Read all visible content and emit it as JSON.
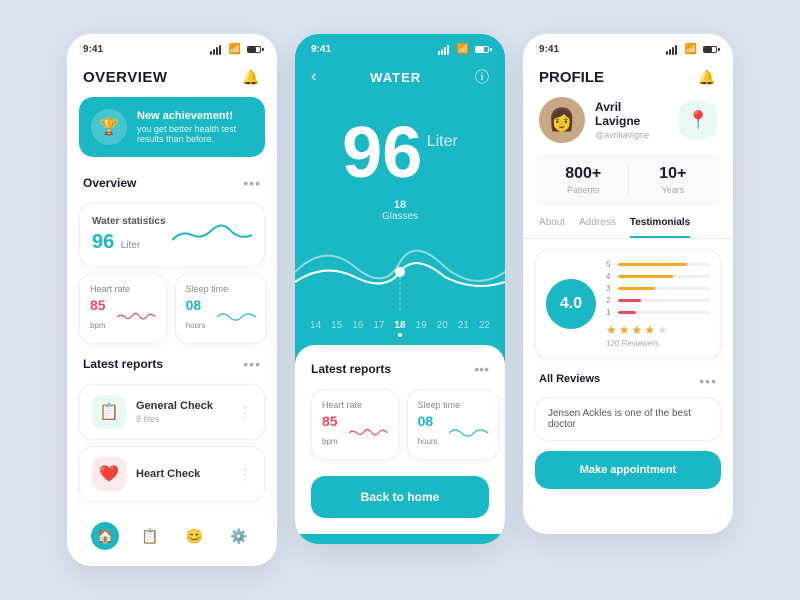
{
  "screens": {
    "overview": {
      "title": "OVERVIEW",
      "status_time": "9:41",
      "achievement": {
        "title": "New achievement!",
        "subtitle": "you get better health test results than before."
      },
      "overview_label": "Overview",
      "water_stats": {
        "title": "Water statistics",
        "value": "96",
        "unit": "Liter"
      },
      "heart_rate": {
        "label": "Heart rate",
        "value": "85",
        "unit": "bpm"
      },
      "sleep_time": {
        "label": "Sleep time",
        "value": "08",
        "unit": "hours"
      },
      "latest_reports": "Latest reports",
      "reports": [
        {
          "name": "General Check",
          "files": "8 files",
          "icon": "📋",
          "color": "green"
        },
        {
          "name": "Heart Check",
          "files": "",
          "icon": "❤️",
          "color": "red"
        }
      ],
      "nav": [
        "🏠",
        "📋",
        "😊",
        "⚙️"
      ]
    },
    "water": {
      "title": "WATER",
      "status_time": "9:41",
      "value": "96",
      "unit": "Liter",
      "glasses_count": "18",
      "glasses_label": "Glasses",
      "dates": [
        "14",
        "15",
        "16",
        "17",
        "18",
        "19",
        "20",
        "21",
        "22"
      ],
      "active_date": "18",
      "latest_reports": "Latest reports",
      "heart_rate": {
        "label": "Heart rate",
        "value": "85",
        "unit": "bpm"
      },
      "sleep_time": {
        "label": "Sleep time",
        "value": "08",
        "unit": "hours"
      },
      "back_btn": "Back to home"
    },
    "profile": {
      "title": "PROFILE",
      "status_time": "9:41",
      "name": "Avril Lavigne",
      "handle": "@avrillavigne",
      "patients": {
        "value": "800+",
        "label": "Patients"
      },
      "years": {
        "value": "10+",
        "label": "Years"
      },
      "tabs": [
        "About",
        "Address",
        "Testimonials"
      ],
      "active_tab": "Testimonials",
      "rating": {
        "score": "4.0",
        "bars": [
          {
            "label": "5",
            "fill": 75,
            "color": "orange"
          },
          {
            "label": "4",
            "fill": 60,
            "color": "orange"
          },
          {
            "label": "3",
            "fill": 40,
            "color": "orange"
          },
          {
            "label": "2",
            "fill": 25,
            "color": "red"
          },
          {
            "label": "1",
            "fill": 20,
            "color": "red"
          }
        ],
        "stars": 4,
        "reviewers": "120 Reviewers"
      },
      "all_reviews": "All Reviews",
      "review_text": "Jensen Ackles is one of the best doctor",
      "appt_btn": "Make appointment"
    }
  }
}
